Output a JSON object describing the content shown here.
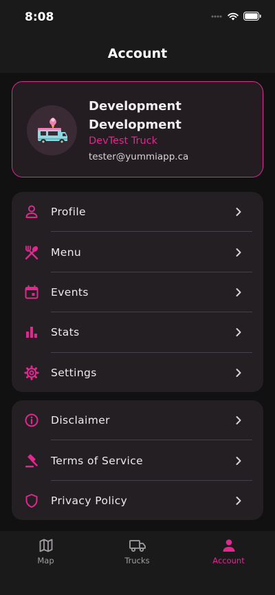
{
  "status_bar": {
    "time": "8:08"
  },
  "header": {
    "title": "Account"
  },
  "profile": {
    "name": "Development Development",
    "truck_name": "DevTest Truck",
    "email": "tester@yummiapp.ca"
  },
  "menu_main": [
    {
      "label": "Profile",
      "icon": "person-icon"
    },
    {
      "label": "Menu",
      "icon": "utensils-icon"
    },
    {
      "label": "Events",
      "icon": "calendar-icon"
    },
    {
      "label": "Stats",
      "icon": "bar-chart-icon"
    },
    {
      "label": "Settings",
      "icon": "gear-icon"
    }
  ],
  "menu_legal": [
    {
      "label": "Disclaimer",
      "icon": "info-icon"
    },
    {
      "label": "Terms of Service",
      "icon": "gavel-icon"
    },
    {
      "label": "Privacy Policy",
      "icon": "shield-icon"
    }
  ],
  "tabs": [
    {
      "label": "Map",
      "icon": "map-icon",
      "active": false
    },
    {
      "label": "Trucks",
      "icon": "truck-icon",
      "active": false
    },
    {
      "label": "Account",
      "icon": "person-icon",
      "active": true
    }
  ],
  "colors": {
    "accent": "#e0288f",
    "background": "#121112",
    "card": "#231f22",
    "text": "#ecebed"
  }
}
